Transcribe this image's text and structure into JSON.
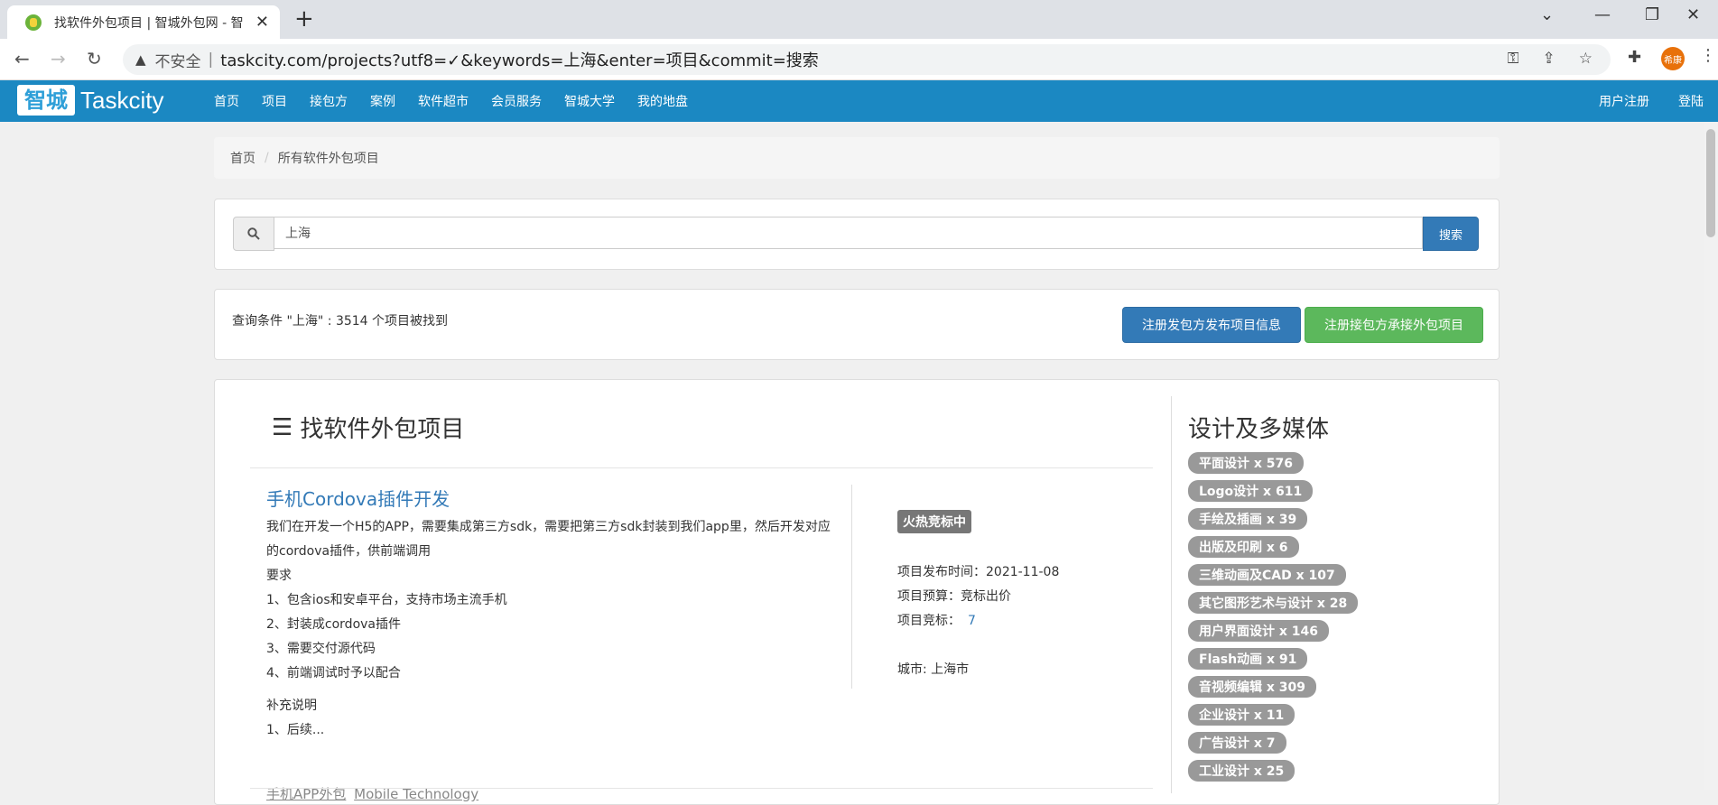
{
  "browser": {
    "tab_title": "找软件外包项目 | 智城外包网 - 智",
    "new_tab": "+",
    "insecure_label": "不安全",
    "url": "taskcity.com/projects?utf8=✓&keywords=上海&enter=项目&commit=搜索",
    "avatar_text": "希康"
  },
  "site_nav": {
    "logo_cn": "智城",
    "logo_en": "Taskcity",
    "links": [
      "首页",
      "项目",
      "接包方",
      "案例",
      "软件超市",
      "会员服务",
      "智城大学",
      "我的地盘"
    ],
    "register": "用户注册",
    "login": "登陆"
  },
  "breadcrumb": {
    "home": "首页",
    "sep": "/",
    "current": "所有软件外包项目"
  },
  "search": {
    "value": "上海",
    "button": "搜索"
  },
  "result": {
    "text": "查询条件 \"上海\" : 3514 个项目被找到",
    "btn_post": "注册发包方发布项目信息",
    "btn_take": "注册接包方承接外包项目"
  },
  "main": {
    "title": "找软件外包项目",
    "project": {
      "title": "手机Cordova插件开发",
      "desc": [
        "我们在开发一个H5的APP，需要集成第三方sdk，需要把第三方sdk封装到我们app里，然后开发对应的cordova插件，供前端调用",
        "要求",
        "1、包含ios和安卓平台，支持市场主流手机",
        "2、封装成cordova插件",
        "3、需要交付源代码",
        "4、前端调试时予以配合",
        "补充说明",
        "1、后续..."
      ],
      "tag1": "手机APP外包",
      "tag2": "Mobile Technology",
      "status": "火热竞标中",
      "publish_label": "项目发布时间：",
      "publish_value": "2021-11-08",
      "budget_label": "项目预算：",
      "budget_value": "竞标出价",
      "bids_label": "项目竞标：",
      "bids_value": "7",
      "city_label": "城市:",
      "city_value": "上海市"
    }
  },
  "sidebar": {
    "title": "设计及多媒体",
    "labels": [
      "平面设计 x 576",
      "Logo设计 x 611",
      "手绘及插画 x 39",
      "出版及印刷 x 6",
      "三维动画及CAD x 107",
      "其它图形艺术与设计 x 28",
      "用户界面设计 x 146",
      "Flash动画 x 91",
      "音视频编辑 x 309",
      "企业设计 x 11",
      "广告设计 x 7",
      "工业设计 x 25"
    ]
  }
}
